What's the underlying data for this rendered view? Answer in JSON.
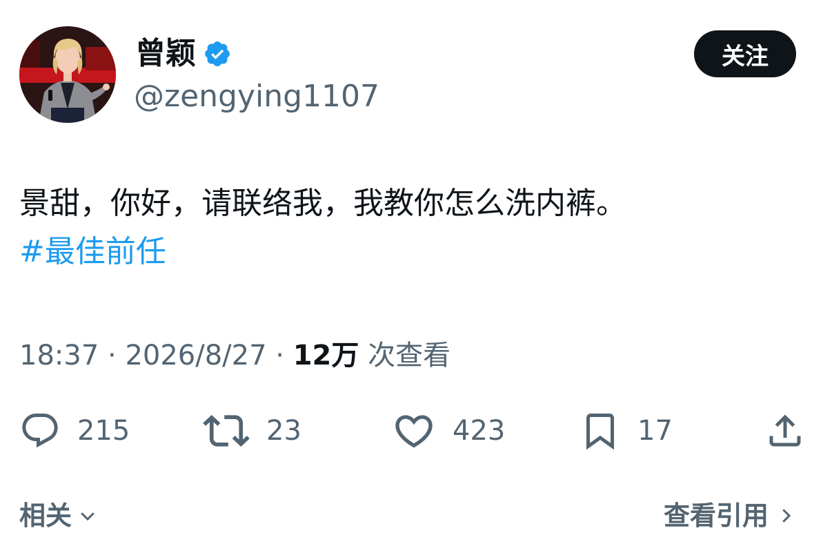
{
  "author": {
    "display_name": "曾颖",
    "handle": "@zengying1107",
    "avatar_icon": "profile-photo",
    "verified_icon": "verified-badge-icon",
    "verified_color": "#1d9bf0"
  },
  "follow_label": "关注",
  "tweet": {
    "text": "景甜，你好，请联络我，我教你怎么洗内裤。",
    "hashtag": "#最佳前任"
  },
  "meta": {
    "time": "18:37",
    "separator": " · ",
    "date": "2026/8/27",
    "views_count": "12万",
    "views_label": " 次查看"
  },
  "actions": {
    "reply": {
      "icon": "reply-icon",
      "count": "215"
    },
    "retweet": {
      "icon": "retweet-icon",
      "count": "23"
    },
    "like": {
      "icon": "heart-icon",
      "count": "423"
    },
    "bookmark": {
      "icon": "bookmark-icon",
      "count": "17"
    },
    "share": {
      "icon": "share-icon"
    }
  },
  "footer": {
    "related_label": "相关",
    "quotes_label": "查看引用"
  },
  "colors": {
    "text": "#0f1419",
    "secondary": "#536471",
    "link": "#1d9bf0",
    "button_bg": "#0f1419"
  }
}
